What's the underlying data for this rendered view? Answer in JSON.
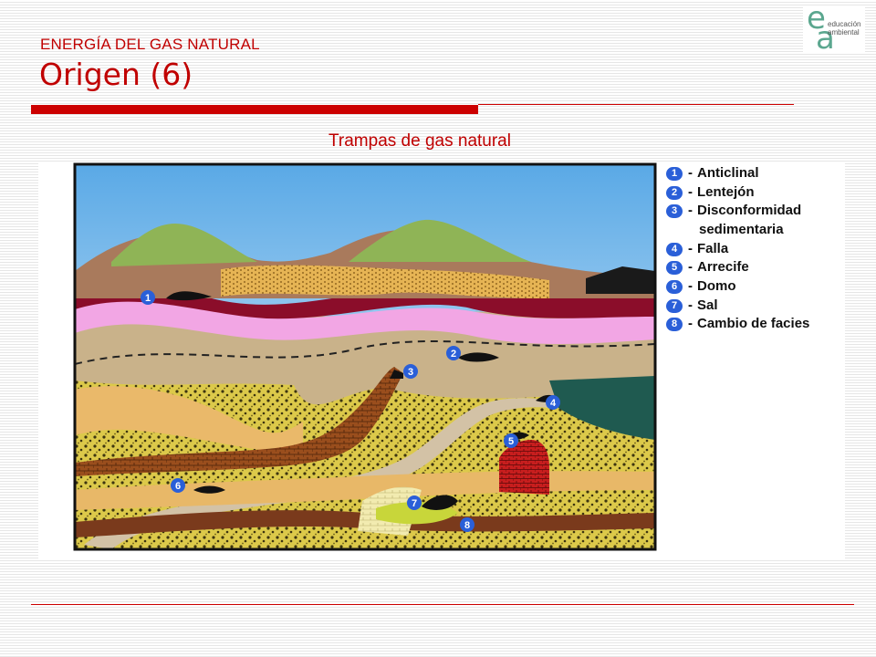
{
  "header": {
    "subtitle": "ENERGÍA DEL GAS NATURAL",
    "title": "Origen (6)"
  },
  "logo": {
    "letter_e": "e",
    "letter_a": "a",
    "line1": "educación",
    "line2": "ambiental"
  },
  "diagram": {
    "title": "Trampas de gas natural",
    "legend": [
      {
        "num": "1",
        "label": "Anticlinal"
      },
      {
        "num": "2",
        "label": "Lentejón"
      },
      {
        "num": "3",
        "label": "Disconformidad",
        "cont": "sedimentaria"
      },
      {
        "num": "4",
        "label": "Falla"
      },
      {
        "num": "5",
        "label": "Arrecife"
      },
      {
        "num": "6",
        "label": "Domo"
      },
      {
        "num": "7",
        "label": "Sal"
      },
      {
        "num": "8",
        "label": "Cambio de facies"
      }
    ],
    "markers": [
      "1",
      "2",
      "3",
      "4",
      "5",
      "6",
      "7",
      "8"
    ]
  },
  "colors": {
    "accent": "#c00000",
    "marker": "#2a5fd8"
  }
}
